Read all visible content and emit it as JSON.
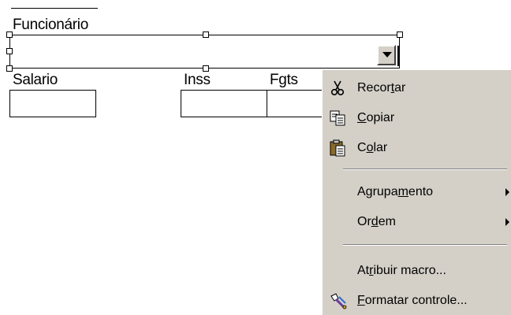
{
  "form": {
    "funcionario_label": "Funcionário",
    "salario_label": "Salario",
    "inss_label": "Inss",
    "fgts_label": "Fgts"
  },
  "context_menu": {
    "items": [
      {
        "before": "Recor",
        "u": "t",
        "after": "ar",
        "icon": "scissors-icon"
      },
      {
        "before": "",
        "u": "C",
        "after": "opiar",
        "icon": "copy-icon"
      },
      {
        "before": "C",
        "u": "o",
        "after": "lar",
        "icon": "paste-icon"
      },
      {
        "before": "Agrupa",
        "u": "m",
        "after": "ento",
        "submenu": true
      },
      {
        "before": "Or",
        "u": "d",
        "after": "em",
        "submenu": true
      },
      {
        "before": "At",
        "u": "r",
        "after": "ibuir macro...",
        "icon": ""
      },
      {
        "before": "",
        "u": "F",
        "after": "ormatar controle...",
        "icon": "format-control-icon"
      }
    ]
  },
  "colors": {
    "menu_background": "#d4d0c8",
    "page_background": "#ffffff"
  }
}
